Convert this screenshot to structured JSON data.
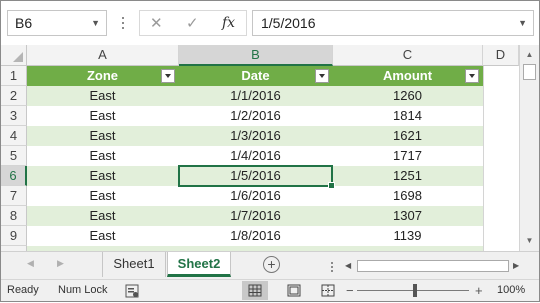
{
  "formula_bar": {
    "name_box": "B6",
    "formula_text": "1/5/2016",
    "cancel_icon": "✕",
    "enter_icon": "✓",
    "fx_icon": "fx"
  },
  "columns": [
    "A",
    "B",
    "C",
    "D"
  ],
  "rows": [
    {
      "num": "1",
      "cells": [
        "Zone",
        "Date",
        "Amount"
      ]
    },
    {
      "num": "2",
      "cells": [
        "East",
        "1/1/2016",
        "1260"
      ]
    },
    {
      "num": "3",
      "cells": [
        "East",
        "1/2/2016",
        "1814"
      ]
    },
    {
      "num": "4",
      "cells": [
        "East",
        "1/3/2016",
        "1621"
      ]
    },
    {
      "num": "5",
      "cells": [
        "East",
        "1/4/2016",
        "1717"
      ]
    },
    {
      "num": "6",
      "cells": [
        "East",
        "1/5/2016",
        "1251"
      ]
    },
    {
      "num": "7",
      "cells": [
        "East",
        "1/6/2016",
        "1698"
      ]
    },
    {
      "num": "8",
      "cells": [
        "East",
        "1/7/2016",
        "1307"
      ]
    },
    {
      "num": "9",
      "cells": [
        "East",
        "1/8/2016",
        "1139"
      ]
    }
  ],
  "sheets": {
    "tab1": "Sheet1",
    "tab2": "Sheet2",
    "active": "Sheet2"
  },
  "status": {
    "ready": "Ready",
    "num_lock": "Num Lock",
    "zoom": "100%"
  },
  "colors": {
    "header_fill": "#70ad47",
    "band_fill": "#e2efda",
    "accent": "#217346"
  },
  "icons": [
    "dropdown-icon",
    "cancel-icon",
    "enter-icon",
    "fx-icon",
    "filter-icon",
    "add-sheet-icon",
    "macro-record-icon",
    "normal-view-icon",
    "page-layout-icon",
    "page-break-icon"
  ]
}
